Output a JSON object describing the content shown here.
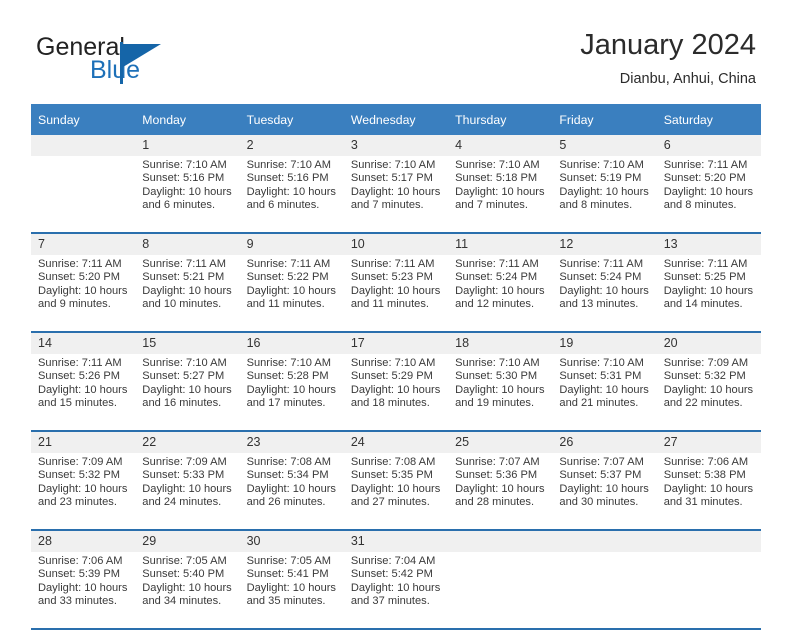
{
  "brand": {
    "name_top": "General",
    "name_bottom": "Blue",
    "accent_color": "#1565a8"
  },
  "header": {
    "title": "January 2024",
    "location": "Dianbu, Anhui, China"
  },
  "theme": {
    "header_bg": "#3a7fbf",
    "row_divider": "#2a6fad",
    "daynum_bg": "#f0f0f0"
  },
  "weekdays": [
    "Sunday",
    "Monday",
    "Tuesday",
    "Wednesday",
    "Thursday",
    "Friday",
    "Saturday"
  ],
  "weeks": [
    {
      "days": [
        {
          "num": "",
          "sunrise": "",
          "sunset": "",
          "daylight1": "",
          "daylight2": ""
        },
        {
          "num": "1",
          "sunrise": "Sunrise: 7:10 AM",
          "sunset": "Sunset: 5:16 PM",
          "daylight1": "Daylight: 10 hours",
          "daylight2": "and 6 minutes."
        },
        {
          "num": "2",
          "sunrise": "Sunrise: 7:10 AM",
          "sunset": "Sunset: 5:16 PM",
          "daylight1": "Daylight: 10 hours",
          "daylight2": "and 6 minutes."
        },
        {
          "num": "3",
          "sunrise": "Sunrise: 7:10 AM",
          "sunset": "Sunset: 5:17 PM",
          "daylight1": "Daylight: 10 hours",
          "daylight2": "and 7 minutes."
        },
        {
          "num": "4",
          "sunrise": "Sunrise: 7:10 AM",
          "sunset": "Sunset: 5:18 PM",
          "daylight1": "Daylight: 10 hours",
          "daylight2": "and 7 minutes."
        },
        {
          "num": "5",
          "sunrise": "Sunrise: 7:10 AM",
          "sunset": "Sunset: 5:19 PM",
          "daylight1": "Daylight: 10 hours",
          "daylight2": "and 8 minutes."
        },
        {
          "num": "6",
          "sunrise": "Sunrise: 7:11 AM",
          "sunset": "Sunset: 5:20 PM",
          "daylight1": "Daylight: 10 hours",
          "daylight2": "and 8 minutes."
        }
      ]
    },
    {
      "days": [
        {
          "num": "7",
          "sunrise": "Sunrise: 7:11 AM",
          "sunset": "Sunset: 5:20 PM",
          "daylight1": "Daylight: 10 hours",
          "daylight2": "and 9 minutes."
        },
        {
          "num": "8",
          "sunrise": "Sunrise: 7:11 AM",
          "sunset": "Sunset: 5:21 PM",
          "daylight1": "Daylight: 10 hours",
          "daylight2": "and 10 minutes."
        },
        {
          "num": "9",
          "sunrise": "Sunrise: 7:11 AM",
          "sunset": "Sunset: 5:22 PM",
          "daylight1": "Daylight: 10 hours",
          "daylight2": "and 11 minutes."
        },
        {
          "num": "10",
          "sunrise": "Sunrise: 7:11 AM",
          "sunset": "Sunset: 5:23 PM",
          "daylight1": "Daylight: 10 hours",
          "daylight2": "and 11 minutes."
        },
        {
          "num": "11",
          "sunrise": "Sunrise: 7:11 AM",
          "sunset": "Sunset: 5:24 PM",
          "daylight1": "Daylight: 10 hours",
          "daylight2": "and 12 minutes."
        },
        {
          "num": "12",
          "sunrise": "Sunrise: 7:11 AM",
          "sunset": "Sunset: 5:24 PM",
          "daylight1": "Daylight: 10 hours",
          "daylight2": "and 13 minutes."
        },
        {
          "num": "13",
          "sunrise": "Sunrise: 7:11 AM",
          "sunset": "Sunset: 5:25 PM",
          "daylight1": "Daylight: 10 hours",
          "daylight2": "and 14 minutes."
        }
      ]
    },
    {
      "days": [
        {
          "num": "14",
          "sunrise": "Sunrise: 7:11 AM",
          "sunset": "Sunset: 5:26 PM",
          "daylight1": "Daylight: 10 hours",
          "daylight2": "and 15 minutes."
        },
        {
          "num": "15",
          "sunrise": "Sunrise: 7:10 AM",
          "sunset": "Sunset: 5:27 PM",
          "daylight1": "Daylight: 10 hours",
          "daylight2": "and 16 minutes."
        },
        {
          "num": "16",
          "sunrise": "Sunrise: 7:10 AM",
          "sunset": "Sunset: 5:28 PM",
          "daylight1": "Daylight: 10 hours",
          "daylight2": "and 17 minutes."
        },
        {
          "num": "17",
          "sunrise": "Sunrise: 7:10 AM",
          "sunset": "Sunset: 5:29 PM",
          "daylight1": "Daylight: 10 hours",
          "daylight2": "and 18 minutes."
        },
        {
          "num": "18",
          "sunrise": "Sunrise: 7:10 AM",
          "sunset": "Sunset: 5:30 PM",
          "daylight1": "Daylight: 10 hours",
          "daylight2": "and 19 minutes."
        },
        {
          "num": "19",
          "sunrise": "Sunrise: 7:10 AM",
          "sunset": "Sunset: 5:31 PM",
          "daylight1": "Daylight: 10 hours",
          "daylight2": "and 21 minutes."
        },
        {
          "num": "20",
          "sunrise": "Sunrise: 7:09 AM",
          "sunset": "Sunset: 5:32 PM",
          "daylight1": "Daylight: 10 hours",
          "daylight2": "and 22 minutes."
        }
      ]
    },
    {
      "days": [
        {
          "num": "21",
          "sunrise": "Sunrise: 7:09 AM",
          "sunset": "Sunset: 5:32 PM",
          "daylight1": "Daylight: 10 hours",
          "daylight2": "and 23 minutes."
        },
        {
          "num": "22",
          "sunrise": "Sunrise: 7:09 AM",
          "sunset": "Sunset: 5:33 PM",
          "daylight1": "Daylight: 10 hours",
          "daylight2": "and 24 minutes."
        },
        {
          "num": "23",
          "sunrise": "Sunrise: 7:08 AM",
          "sunset": "Sunset: 5:34 PM",
          "daylight1": "Daylight: 10 hours",
          "daylight2": "and 26 minutes."
        },
        {
          "num": "24",
          "sunrise": "Sunrise: 7:08 AM",
          "sunset": "Sunset: 5:35 PM",
          "daylight1": "Daylight: 10 hours",
          "daylight2": "and 27 minutes."
        },
        {
          "num": "25",
          "sunrise": "Sunrise: 7:07 AM",
          "sunset": "Sunset: 5:36 PM",
          "daylight1": "Daylight: 10 hours",
          "daylight2": "and 28 minutes."
        },
        {
          "num": "26",
          "sunrise": "Sunrise: 7:07 AM",
          "sunset": "Sunset: 5:37 PM",
          "daylight1": "Daylight: 10 hours",
          "daylight2": "and 30 minutes."
        },
        {
          "num": "27",
          "sunrise": "Sunrise: 7:06 AM",
          "sunset": "Sunset: 5:38 PM",
          "daylight1": "Daylight: 10 hours",
          "daylight2": "and 31 minutes."
        }
      ]
    },
    {
      "days": [
        {
          "num": "28",
          "sunrise": "Sunrise: 7:06 AM",
          "sunset": "Sunset: 5:39 PM",
          "daylight1": "Daylight: 10 hours",
          "daylight2": "and 33 minutes."
        },
        {
          "num": "29",
          "sunrise": "Sunrise: 7:05 AM",
          "sunset": "Sunset: 5:40 PM",
          "daylight1": "Daylight: 10 hours",
          "daylight2": "and 34 minutes."
        },
        {
          "num": "30",
          "sunrise": "Sunrise: 7:05 AM",
          "sunset": "Sunset: 5:41 PM",
          "daylight1": "Daylight: 10 hours",
          "daylight2": "and 35 minutes."
        },
        {
          "num": "31",
          "sunrise": "Sunrise: 7:04 AM",
          "sunset": "Sunset: 5:42 PM",
          "daylight1": "Daylight: 10 hours",
          "daylight2": "and 37 minutes."
        },
        {
          "num": "",
          "sunrise": "",
          "sunset": "",
          "daylight1": "",
          "daylight2": ""
        },
        {
          "num": "",
          "sunrise": "",
          "sunset": "",
          "daylight1": "",
          "daylight2": ""
        },
        {
          "num": "",
          "sunrise": "",
          "sunset": "",
          "daylight1": "",
          "daylight2": ""
        }
      ]
    }
  ]
}
